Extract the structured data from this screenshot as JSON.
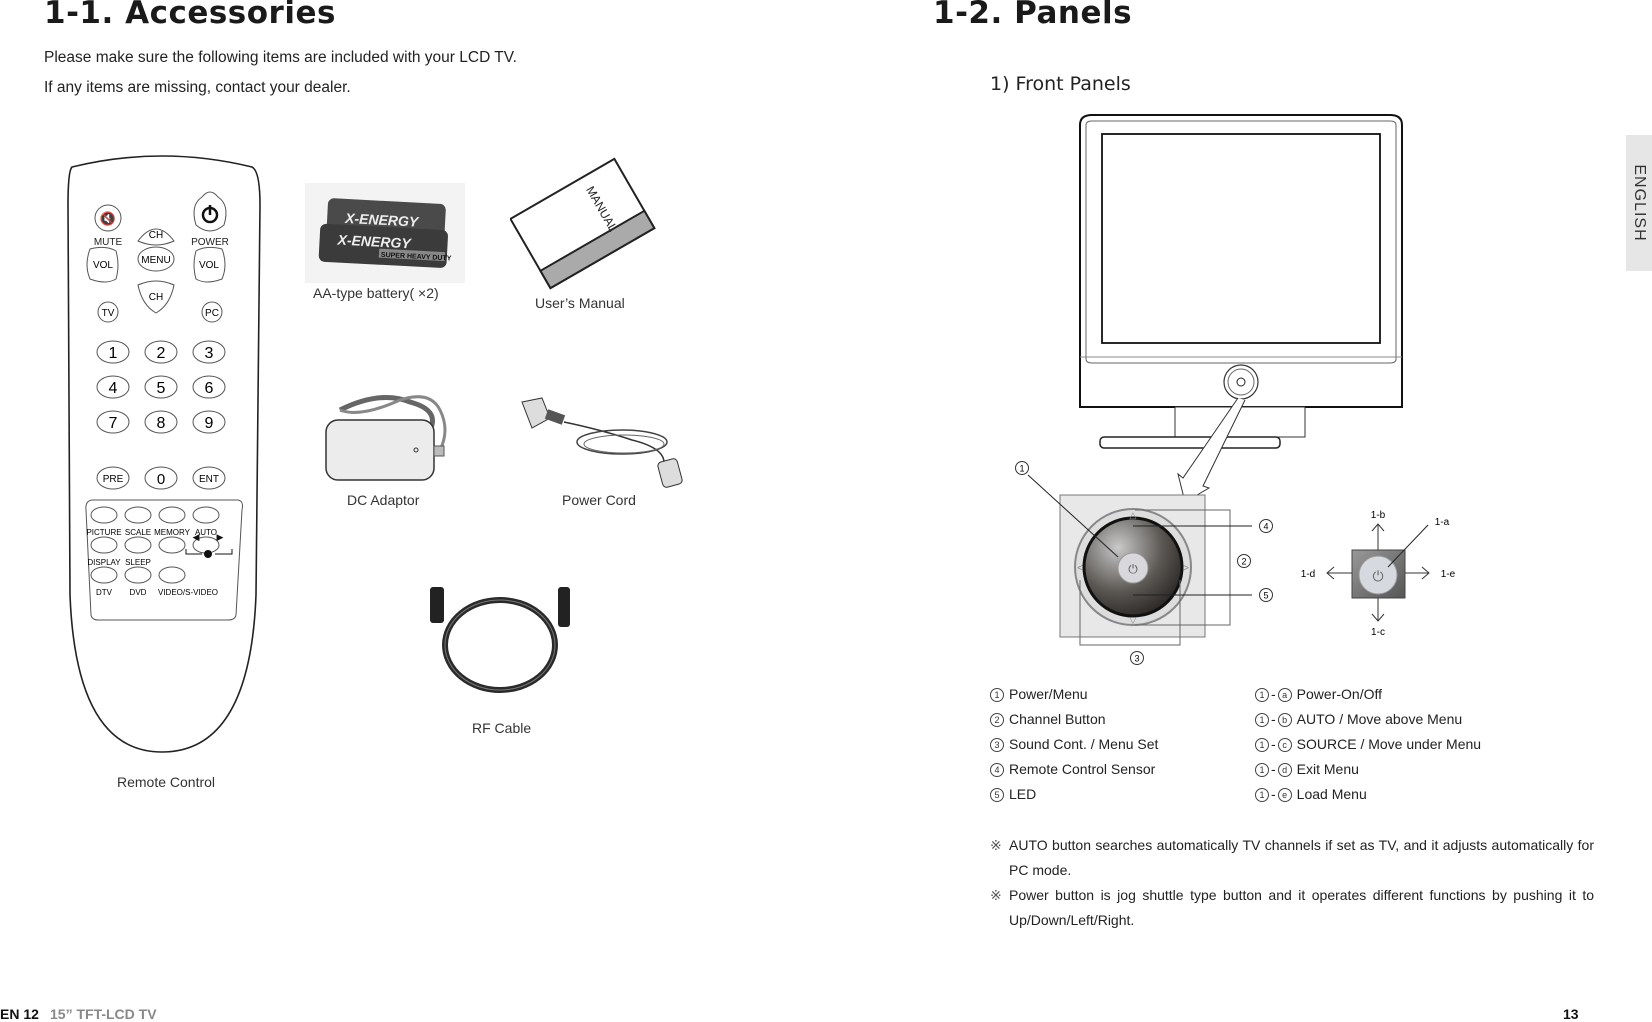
{
  "left_page": {
    "title": "1-1. Accessories",
    "intro_lines": [
      "Please make sure the following items are included with your LCD TV.",
      "If any items are missing, contact your dealer."
    ],
    "items": {
      "remote": "Remote Control",
      "battery": "AA-type battery( ×2)",
      "manual": "User’s Manual",
      "adaptor": "DC Adaptor",
      "power_cord": "Power Cord",
      "rf_cable": "RF Cable"
    },
    "battery_brand": "X-ENERGY",
    "battery_subtext": "SUPER HEAVY DUTY",
    "manual_cover_text": "MANUAL",
    "remote_buttons": {
      "mute": "MUTE",
      "power": "POWER",
      "ch_up": "CH",
      "ch_down": "CH",
      "vol_left": "VOL",
      "vol_right": "VOL",
      "menu": "MENU",
      "tv": "TV",
      "pc": "PC",
      "digits": [
        "1",
        "2",
        "3",
        "4",
        "5",
        "6",
        "7",
        "8",
        "9"
      ],
      "pre": "PRE",
      "zero": "0",
      "ent": "ENT",
      "row1": [
        "PICTURE",
        "SCALE",
        "MEMORY",
        "AUTO"
      ],
      "row2": [
        "DISPLAY",
        "SLEEP"
      ],
      "row3": [
        "DTV",
        "DVD",
        "VIDEO/S-VIDEO"
      ]
    },
    "footer": {
      "page": "EN 12",
      "product": "15” TFT-LCD TV"
    }
  },
  "right_page": {
    "title": "1-2. Panels",
    "subtitle": "1) Front Panels",
    "callouts": {
      "c1": "1",
      "c2": "2",
      "c3": "3",
      "c4": "4",
      "c5": "5",
      "a": "1-a",
      "b": "1-b",
      "c": "1-c",
      "d": "1-d",
      "e": "1-e"
    },
    "legend_left": [
      {
        "num": "1",
        "label": "Power/Menu"
      },
      {
        "num": "2",
        "label": "Channel Button"
      },
      {
        "num": "3",
        "label": "Sound Cont. / Menu Set"
      },
      {
        "num": "4",
        "label": "Remote Control Sensor"
      },
      {
        "num": "5",
        "label": "LED"
      }
    ],
    "legend_right": [
      {
        "num": "1",
        "sub": "a",
        "label": "Power-On/Off"
      },
      {
        "num": "1",
        "sub": "b",
        "label": "AUTO / Move above Menu"
      },
      {
        "num": "1",
        "sub": "c",
        "label": "SOURCE / Move under Menu"
      },
      {
        "num": "1",
        "sub": "d",
        "label": "Exit Menu"
      },
      {
        "num": "1",
        "sub": "e",
        "label": "Load Menu"
      }
    ],
    "notes": [
      {
        "mark": "※",
        "text": "AUTO button searches automatically TV channels if set as TV, and it adjusts automatically for PC mode."
      },
      {
        "mark": "※",
        "text": "Power button is jog shuttle type button and it operates different functions by pushing it to Up/Down/Left/Right."
      }
    ],
    "side_tab": "ENGLISH",
    "footer": {
      "page": "13"
    }
  }
}
